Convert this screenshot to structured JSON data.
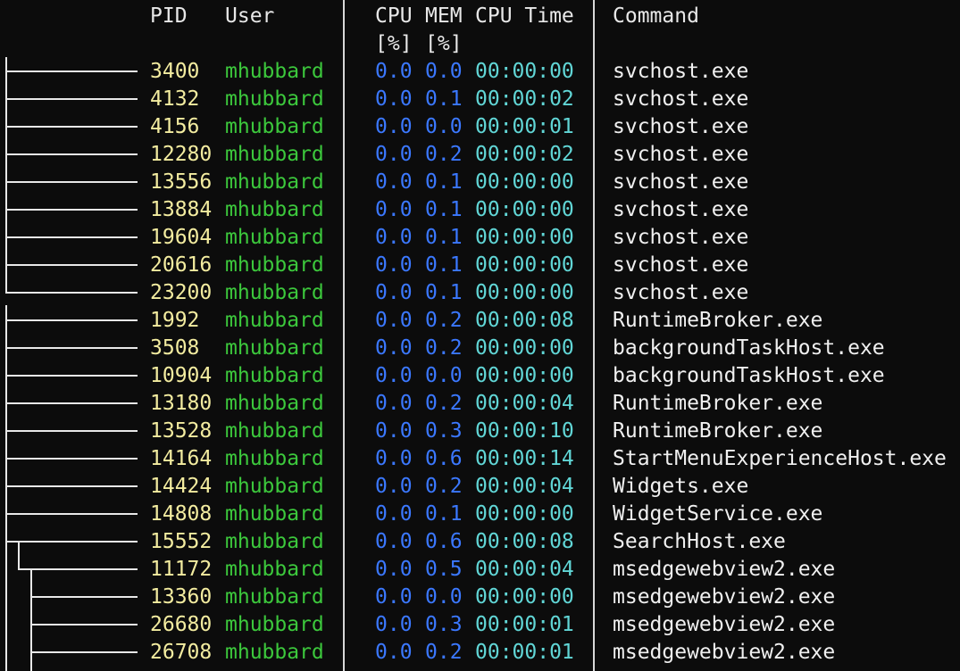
{
  "header": {
    "pid": "PID",
    "user": "User",
    "cpu": "CPU",
    "mem": "MEM",
    "cpu_time": "CPU Time",
    "command": "Command",
    "cpu_unit": "[%]",
    "mem_unit": "[%]"
  },
  "rows": [
    {
      "pid": "3400",
      "user": "mhubbard",
      "cpu": "0.0",
      "mem": "0.0",
      "time": "00:00:00",
      "cmd": "svchost.exe"
    },
    {
      "pid": "4132",
      "user": "mhubbard",
      "cpu": "0.0",
      "mem": "0.1",
      "time": "00:00:02",
      "cmd": "svchost.exe"
    },
    {
      "pid": "4156",
      "user": "mhubbard",
      "cpu": "0.0",
      "mem": "0.0",
      "time": "00:00:01",
      "cmd": "svchost.exe"
    },
    {
      "pid": "12280",
      "user": "mhubbard",
      "cpu": "0.0",
      "mem": "0.2",
      "time": "00:00:02",
      "cmd": "svchost.exe"
    },
    {
      "pid": "13556",
      "user": "mhubbard",
      "cpu": "0.0",
      "mem": "0.1",
      "time": "00:00:00",
      "cmd": "svchost.exe"
    },
    {
      "pid": "13884",
      "user": "mhubbard",
      "cpu": "0.0",
      "mem": "0.1",
      "time": "00:00:00",
      "cmd": "svchost.exe"
    },
    {
      "pid": "19604",
      "user": "mhubbard",
      "cpu": "0.0",
      "mem": "0.1",
      "time": "00:00:00",
      "cmd": "svchost.exe"
    },
    {
      "pid": "20616",
      "user": "mhubbard",
      "cpu": "0.0",
      "mem": "0.1",
      "time": "00:00:00",
      "cmd": "svchost.exe"
    },
    {
      "pid": "23200",
      "user": "mhubbard",
      "cpu": "0.0",
      "mem": "0.1",
      "time": "00:00:00",
      "cmd": "svchost.exe"
    },
    {
      "pid": "1992",
      "user": "mhubbard",
      "cpu": "0.0",
      "mem": "0.2",
      "time": "00:00:08",
      "cmd": "RuntimeBroker.exe"
    },
    {
      "pid": "3508",
      "user": "mhubbard",
      "cpu": "0.0",
      "mem": "0.2",
      "time": "00:00:00",
      "cmd": "backgroundTaskHost.exe"
    },
    {
      "pid": "10904",
      "user": "mhubbard",
      "cpu": "0.0",
      "mem": "0.0",
      "time": "00:00:00",
      "cmd": "backgroundTaskHost.exe"
    },
    {
      "pid": "13180",
      "user": "mhubbard",
      "cpu": "0.0",
      "mem": "0.2",
      "time": "00:00:04",
      "cmd": "RuntimeBroker.exe"
    },
    {
      "pid": "13528",
      "user": "mhubbard",
      "cpu": "0.0",
      "mem": "0.3",
      "time": "00:00:10",
      "cmd": "RuntimeBroker.exe"
    },
    {
      "pid": "14164",
      "user": "mhubbard",
      "cpu": "0.0",
      "mem": "0.6",
      "time": "00:00:14",
      "cmd": "StartMenuExperienceHost.exe"
    },
    {
      "pid": "14424",
      "user": "mhubbard",
      "cpu": "0.0",
      "mem": "0.2",
      "time": "00:00:04",
      "cmd": "Widgets.exe"
    },
    {
      "pid": "14808",
      "user": "mhubbard",
      "cpu": "0.0",
      "mem": "0.1",
      "time": "00:00:00",
      "cmd": "WidgetService.exe"
    },
    {
      "pid": "15552",
      "user": "mhubbard",
      "cpu": "0.0",
      "mem": "0.6",
      "time": "00:00:08",
      "cmd": "SearchHost.exe"
    },
    {
      "pid": "11172",
      "user": "mhubbard",
      "cpu": "0.0",
      "mem": "0.5",
      "time": "00:00:04",
      "cmd": "msedgewebview2.exe"
    },
    {
      "pid": "13360",
      "user": "mhubbard",
      "cpu": "0.0",
      "mem": "0.0",
      "time": "00:00:00",
      "cmd": "msedgewebview2.exe"
    },
    {
      "pid": "26680",
      "user": "mhubbard",
      "cpu": "0.0",
      "mem": "0.3",
      "time": "00:00:01",
      "cmd": "msedgewebview2.exe"
    },
    {
      "pid": "26708",
      "user": "mhubbard",
      "cpu": "0.0",
      "mem": "0.2",
      "time": "00:00:01",
      "cmd": "msedgewebview2.exe"
    }
  ],
  "colors": {
    "background": "#0c0c0c",
    "pid": "#f3eca0",
    "user": "#3cc83c",
    "cpu_mem": "#3b78ff",
    "time": "#61d6d6",
    "command": "#f0f0f0"
  }
}
